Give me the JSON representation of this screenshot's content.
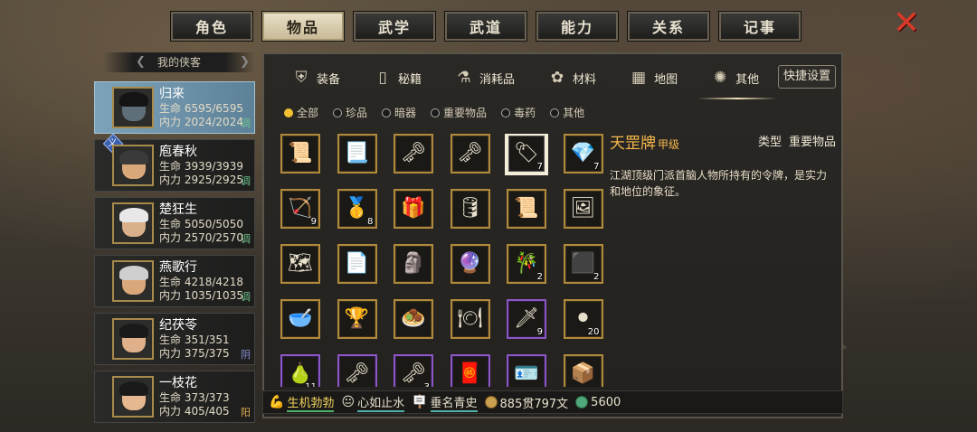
{
  "top_tabs": [
    "角色",
    "物品",
    "武学",
    "武道",
    "能力",
    "关系",
    "记事"
  ],
  "active_top_tab": 1,
  "roster": {
    "header": "我的侠客",
    "heroes": [
      {
        "name": "归来",
        "hp_label": "生命",
        "hp": "6595/6595",
        "mp_label": "内力",
        "mp": "2024/2024",
        "tag": "调",
        "tag_kind": "tune",
        "active": true,
        "badge": "",
        "hair": "#141414",
        "skin": "#5f6f7a"
      },
      {
        "name": "庖春秋",
        "hp_label": "生命",
        "hp": "3939/3939",
        "mp_label": "内力",
        "mp": "2925/2925",
        "tag": "调",
        "tag_kind": "tune",
        "active": false,
        "badge": "义",
        "hair": "#3a3a3a",
        "skin": "#d9a87a"
      },
      {
        "name": "楚狂生",
        "hp_label": "生命",
        "hp": "5050/5050",
        "mp_label": "内力",
        "mp": "2570/2570",
        "tag": "调",
        "tag_kind": "tune",
        "active": false,
        "badge": "",
        "hair": "#e8e8e8",
        "skin": "#d9b08a"
      },
      {
        "name": "燕歌行",
        "hp_label": "生命",
        "hp": "4218/4218",
        "mp_label": "内力",
        "mp": "1035/1035",
        "tag": "调",
        "tag_kind": "tune",
        "active": false,
        "badge": "",
        "hair": "#cfcfcf",
        "skin": "#d9a87a"
      },
      {
        "name": "纪茯苓",
        "hp_label": "生命",
        "hp": "351/351",
        "mp_label": "内力",
        "mp": "375/375",
        "tag": "阴",
        "tag_kind": "yin",
        "active": false,
        "badge": "",
        "hair": "#1a1a1a",
        "skin": "#e0b08a"
      },
      {
        "name": "一枝花",
        "hp_label": "生命",
        "hp": "373/373",
        "mp_label": "内力",
        "mp": "405/405",
        "tag": "阳",
        "tag_kind": "yang",
        "active": false,
        "badge": "",
        "hair": "#1a1a1a",
        "skin": "#e6b890"
      }
    ]
  },
  "sub_tabs": [
    {
      "label": "装备",
      "icon": "armor-icon",
      "glyph": "⛨"
    },
    {
      "label": "秘籍",
      "icon": "book-icon",
      "glyph": "▯"
    },
    {
      "label": "消耗品",
      "icon": "potion-icon",
      "glyph": "⚗"
    },
    {
      "label": "材料",
      "icon": "herb-icon",
      "glyph": "✿"
    },
    {
      "label": "地图",
      "icon": "map-icon",
      "glyph": "▦"
    },
    {
      "label": "其他",
      "icon": "medal-icon",
      "glyph": "✺"
    }
  ],
  "active_sub_tab": 5,
  "quick_settings": "快捷设置",
  "filters": [
    {
      "label": "全部",
      "on": true
    },
    {
      "label": "珍品",
      "on": false
    },
    {
      "label": "暗器",
      "on": false
    },
    {
      "label": "重要物品",
      "on": false
    },
    {
      "label": "毒药",
      "on": false
    },
    {
      "label": "其他",
      "on": false
    }
  ],
  "items": [
    {
      "icon": "scroll-icon",
      "glyph": "📜",
      "count": "",
      "rarity": "gold"
    },
    {
      "icon": "bamboo-scroll-icon",
      "glyph": "📃",
      "count": "",
      "rarity": "gold"
    },
    {
      "icon": "key-icon",
      "glyph": "🗝",
      "count": "",
      "rarity": "gold"
    },
    {
      "icon": "red-key-icon",
      "glyph": "🗝",
      "count": "",
      "rarity": "gold"
    },
    {
      "icon": "token-plaque-icon",
      "glyph": "🏷",
      "count": "7",
      "rarity": "gold",
      "selected": true
    },
    {
      "icon": "crystal-icon",
      "glyph": "💎",
      "count": "7",
      "rarity": "gold"
    },
    {
      "icon": "arrows-bundle-icon",
      "glyph": "🏹",
      "count": "9",
      "rarity": "gold"
    },
    {
      "icon": "gold-ingot-icon",
      "glyph": "🥇",
      "count": "8",
      "rarity": "gold"
    },
    {
      "icon": "jade-box-icon",
      "glyph": "🎁",
      "count": "",
      "rarity": "gold"
    },
    {
      "icon": "barrel-icon",
      "glyph": "🛢",
      "count": "",
      "rarity": "gold"
    },
    {
      "icon": "scroll-open-icon",
      "glyph": "📜",
      "count": "",
      "rarity": "gold"
    },
    {
      "icon": "painting-icon",
      "glyph": "🖼",
      "count": "",
      "rarity": "gold"
    },
    {
      "icon": "map-scroll-icon",
      "glyph": "🗺",
      "count": "",
      "rarity": "gold"
    },
    {
      "icon": "calligraphy-icon",
      "glyph": "📄",
      "count": "",
      "rarity": "gold"
    },
    {
      "icon": "jade-statue-icon",
      "glyph": "🗿",
      "count": "",
      "rarity": "gold"
    },
    {
      "icon": "crystal-ball-icon",
      "glyph": "🔮",
      "count": "",
      "rarity": "gold"
    },
    {
      "icon": "flute-icon",
      "glyph": "🎋",
      "count": "2",
      "rarity": "gold"
    },
    {
      "icon": "ink-stone-icon",
      "glyph": "⬛",
      "count": "2",
      "rarity": "gold"
    },
    {
      "icon": "porcelain-bowl-icon",
      "glyph": "🥣",
      "count": "",
      "rarity": "gold"
    },
    {
      "icon": "gold-cup-icon",
      "glyph": "🏆",
      "count": "",
      "rarity": "gold"
    },
    {
      "icon": "go-board-icon",
      "glyph": "🧆",
      "count": "",
      "rarity": "gold"
    },
    {
      "icon": "plate-icon",
      "glyph": "🍽",
      "count": "",
      "rarity": "gold"
    },
    {
      "icon": "dagger-icon",
      "glyph": "🗡",
      "count": "9",
      "rarity": "purple"
    },
    {
      "icon": "iron-balls-icon",
      "glyph": "⚫",
      "count": "20",
      "rarity": "gold"
    },
    {
      "icon": "gourd-icon",
      "glyph": "🍐",
      "count": "11",
      "rarity": "purple"
    },
    {
      "icon": "blue-key-icon",
      "glyph": "🗝",
      "count": "",
      "rarity": "purple"
    },
    {
      "icon": "bronze-key-icon",
      "glyph": "🗝",
      "count": "3",
      "rarity": "purple"
    },
    {
      "icon": "talisman-icon",
      "glyph": "🧧",
      "count": "",
      "rarity": "purple"
    },
    {
      "icon": "dark-token-icon",
      "glyph": "🪪",
      "count": "",
      "rarity": "purple"
    },
    {
      "icon": "box-icon",
      "glyph": "📦",
      "count": "",
      "rarity": "gold"
    }
  ],
  "detail": {
    "name": "天罡牌",
    "grade": "甲级",
    "type_label": "类型",
    "type_value": "重要物品",
    "description": "江湖顶级门派首脑人物所持有的令牌，是实力和地位的象征。"
  },
  "status": {
    "vitality": "生机勃勃",
    "mood": "心如止水",
    "fame": "垂名青史",
    "money": "885贯797文",
    "jade": "5600"
  },
  "colors": {
    "accent_gold": "#b08a3c",
    "rarity_purple": "#8a57c4",
    "close_red": "#d83a2a",
    "title_orange": "#f5b84a"
  }
}
